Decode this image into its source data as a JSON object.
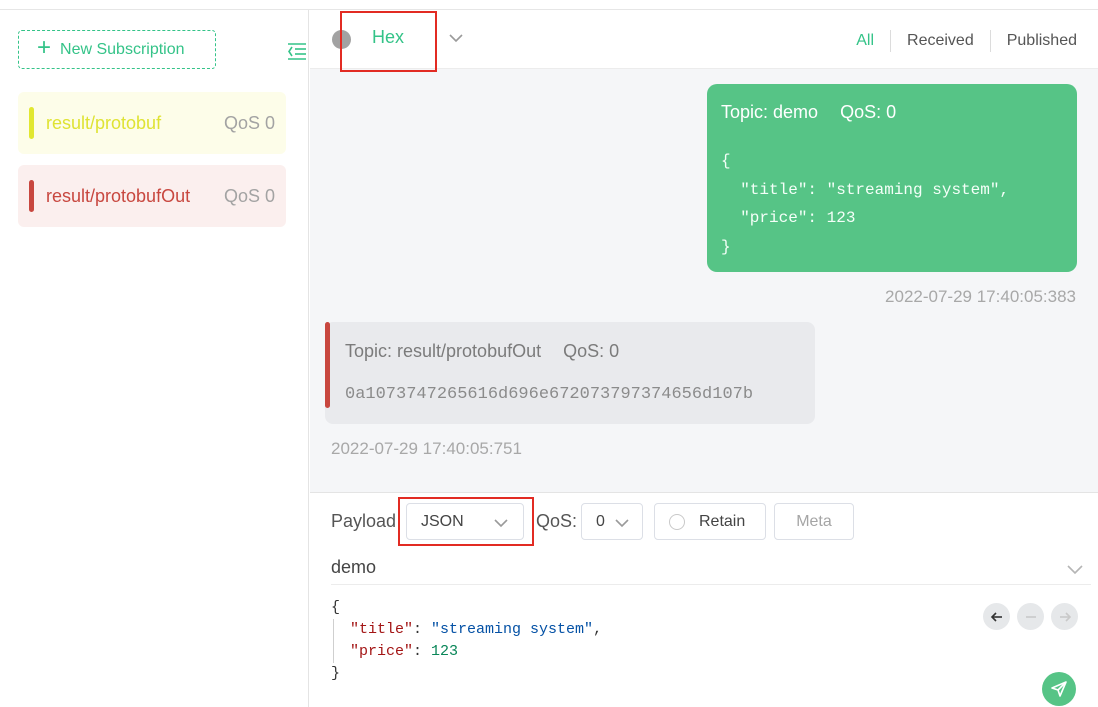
{
  "sidebar": {
    "new_subscription_label": "New Subscription",
    "subscriptions": [
      {
        "topic": "result/protobuf",
        "qos": "QoS 0",
        "color": "#e1e731"
      },
      {
        "topic": "result/protobufOut",
        "qos": "QoS 0",
        "color": "#c8473f"
      }
    ]
  },
  "toolbar": {
    "payload_format": "Hex",
    "filters": {
      "all": "All",
      "received": "Received",
      "published": "Published"
    },
    "active_filter": "All"
  },
  "messages": [
    {
      "direction": "sent",
      "topic_label": "Topic: demo",
      "qos_label": "QoS: 0",
      "payload": "{\n  \"title\": \"streaming system\",\n  \"price\": 123\n}",
      "time": "2022-07-29 17:40:05:383",
      "color": "#56c486"
    },
    {
      "direction": "received",
      "topic_label": "Topic: result/protobufOut",
      "qos_label": "QoS: 0",
      "payload": "0a1073747265616d696e672073797374656d107b",
      "time": "2022-07-29 17:40:05:751",
      "color": "#c8473f"
    }
  ],
  "publish": {
    "payload_label": "Payload",
    "payload_type": "JSON",
    "qos_label": "QoS:",
    "qos_value": "0",
    "retain_label": "Retain",
    "meta_label": "Meta",
    "topic": "demo",
    "editor": {
      "open_brace": "{",
      "title_key": "\"title\"",
      "title_value": "\"streaming system\"",
      "price_key": "\"price\"",
      "price_value": "123",
      "close_brace": "}"
    }
  },
  "colors": {
    "accent": "#34c388",
    "highlight_box": "#e22b23"
  }
}
